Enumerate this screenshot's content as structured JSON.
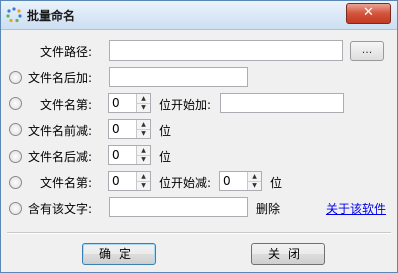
{
  "window": {
    "title": "批量命名",
    "close_label": "✕"
  },
  "form": {
    "path_label": "文件路径:",
    "path_value": "",
    "browse_label": "...",
    "suffix_label": "文件名后加:",
    "suffix_value": "",
    "nth_add_label": "文件名第:",
    "nth_add_value": "0",
    "nth_add_suffix": "位开始加:",
    "nth_add_text": "",
    "prefix_remove_label": "文件名前减:",
    "prefix_remove_value": "0",
    "prefix_remove_unit": "位",
    "suffix_remove_label": "文件名后减:",
    "suffix_remove_value": "0",
    "suffix_remove_unit": "位",
    "nth_remove_label": "文件名第:",
    "nth_remove_value": "0",
    "nth_remove_mid": "位开始减:",
    "nth_remove_count": "0",
    "nth_remove_unit": "位",
    "contains_label": "含有该文字:",
    "contains_value": "",
    "delete_label": "删除",
    "about_link": "关于该软件"
  },
  "buttons": {
    "ok": "确定",
    "close": "关闭"
  },
  "icons": {
    "spin_up": "▲",
    "spin_down": "▼"
  }
}
